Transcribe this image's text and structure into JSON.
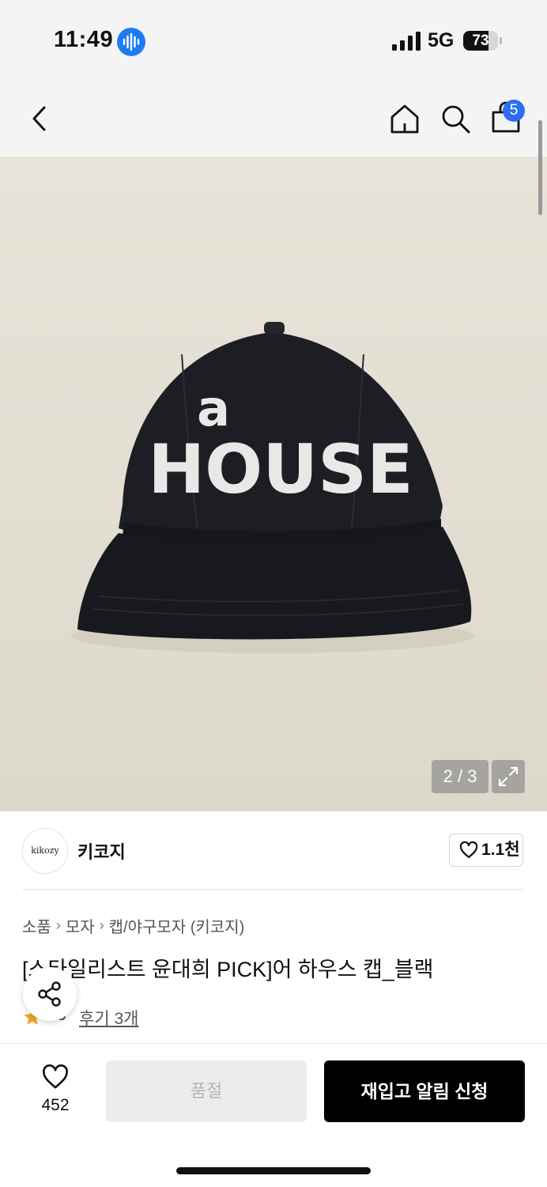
{
  "status_bar": {
    "time": "11:49",
    "network": "5G",
    "battery_level": "73",
    "battery_fraction": 0.73
  },
  "header": {
    "cart_count": "5"
  },
  "gallery": {
    "counter": "2 / 3",
    "cap_text_small": "a",
    "cap_text_large": "HOUSE"
  },
  "brand": {
    "logo_text": "kikozy",
    "name": "키코지",
    "like_count": "1.1천"
  },
  "breadcrumb": [
    "소품",
    "모자",
    "캡/야구모자 (키코지)"
  ],
  "product": {
    "title": "[스타일리스트 윤대희 PICK]어 하우스 캡_블랙"
  },
  "rating": {
    "value": ".3",
    "reviews": "후기 3개"
  },
  "bottom": {
    "wish_count": "452",
    "soldout_label": "품절",
    "restock_label": "재입고 알림 신청"
  },
  "colors": {
    "accent": "#2b6ef2",
    "star": "#f5a623",
    "cta": "#000000",
    "siri": "#1e7cf2"
  }
}
